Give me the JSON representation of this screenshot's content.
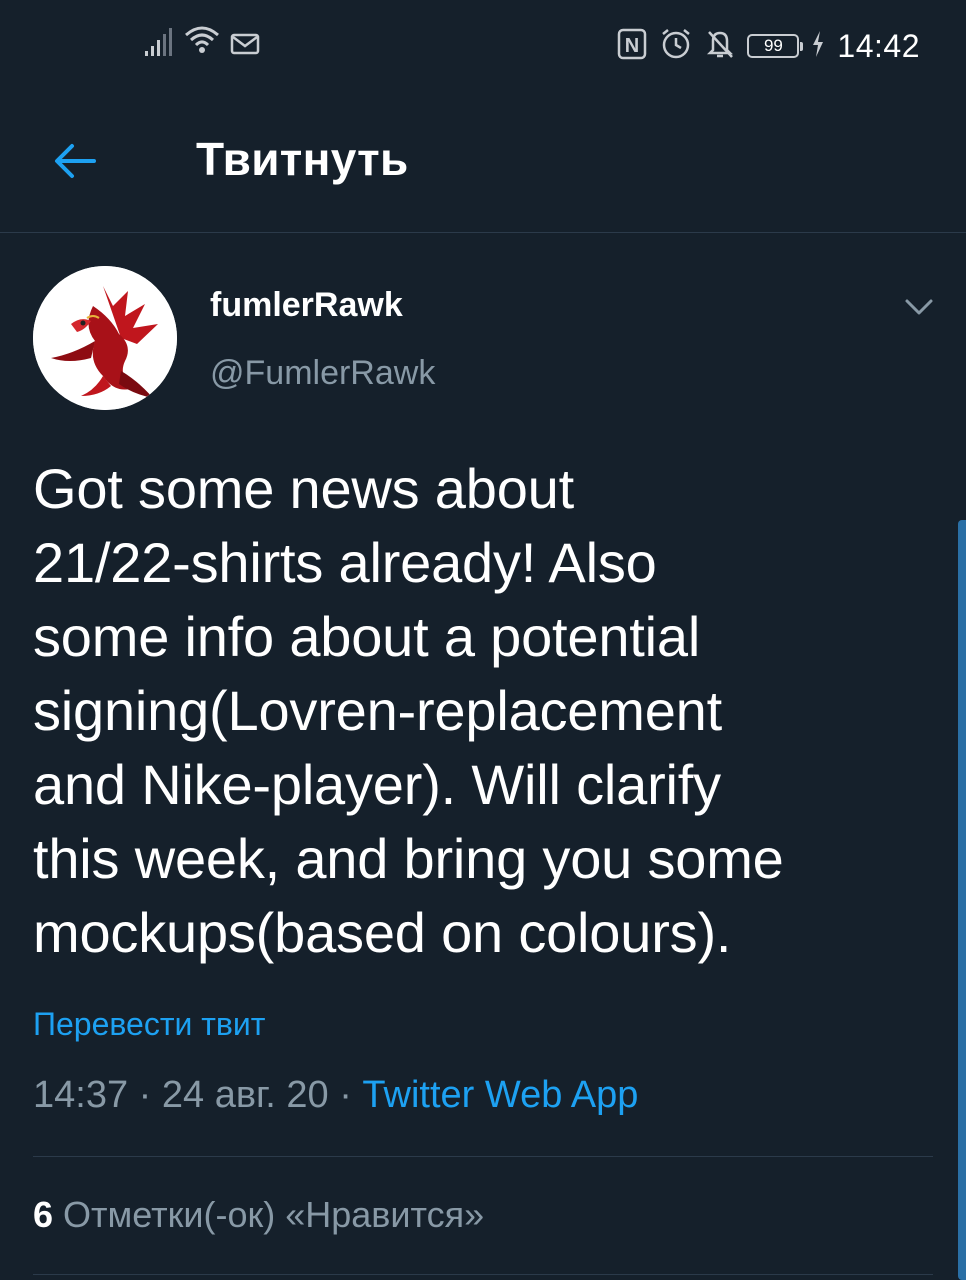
{
  "status_bar": {
    "time": "14:42",
    "battery": "99",
    "nfc_label": "N",
    "icons": [
      "signal-icon",
      "wifi-icon",
      "mail-icon",
      "nfc-icon",
      "alarm-icon",
      "mute-icon",
      "battery-icon",
      "charging-icon"
    ]
  },
  "header": {
    "title": "Твитнуть",
    "back_icon": "back-arrow-icon"
  },
  "tweet": {
    "display_name": "fumlerRawk",
    "handle": "@FumlerRawk",
    "text": "Got some news about\n21/22-shirts already! Also\nsome info about a potential\nsigning(Lovren-replacement\nand Nike-player). Will clarify\nthis week, and bring you some\nmockups(based on colours).",
    "translate_label": "Перевести твит",
    "time": "14:37",
    "separator": "·",
    "date": "24 авг. 20",
    "source": "Twitter Web App",
    "likes_count": "6",
    "likes_label": "Отметки(-ок) «Нравится»"
  },
  "colors": {
    "background": "#15202b",
    "accent": "#1da1f2",
    "secondary_text": "#8899a6",
    "divider": "#2b3a4a"
  }
}
